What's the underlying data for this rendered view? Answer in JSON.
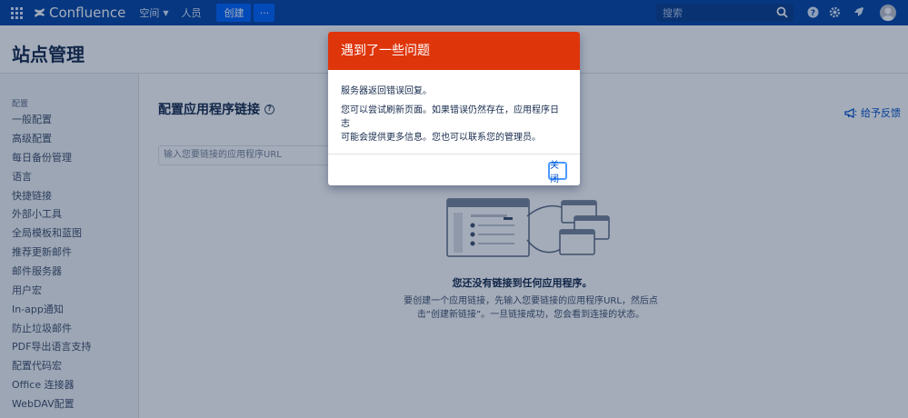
{
  "topnav": {
    "logo_text": "Confluence",
    "spaces_label": "空间",
    "people_label": "人员",
    "create_label": "创建",
    "more_label": "···",
    "search_placeholder": "搜索"
  },
  "header": {
    "title": "站点管理"
  },
  "sidebar": {
    "heading": "配置",
    "items": [
      {
        "label": "一般配置"
      },
      {
        "label": "高级配置"
      },
      {
        "label": "每日备份管理"
      },
      {
        "label": "语言"
      },
      {
        "label": "快捷链接"
      },
      {
        "label": "外部小工具"
      },
      {
        "label": "全局模板和蓝图"
      },
      {
        "label": "推荐更新邮件"
      },
      {
        "label": "邮件服务器"
      },
      {
        "label": "用户宏"
      },
      {
        "label": "In-app通知"
      },
      {
        "label": "防止垃圾邮件"
      },
      {
        "label": "PDF导出语言支持"
      },
      {
        "label": "配置代码宏"
      },
      {
        "label": "Office 连接器"
      },
      {
        "label": "WebDAV配置"
      }
    ]
  },
  "main": {
    "title": "配置应用程序链接",
    "feedback_label": "给予反馈",
    "url_placeholder": "输入您要链接的应用程序URL",
    "empty_title": "您还没有链接到任何应用程序。",
    "empty_desc_line1": "要创建一个应用链接，先输入您要链接的应用程序URL，然后点",
    "empty_desc_line2": "击“创建新链接”。一旦链接成功，您会看到连接的状态。"
  },
  "dialog": {
    "title": "遇到了一些问题",
    "message": "服务器返回错误回复。",
    "detail_line1": "您可以尝试刷新页面。如果错误仍然存在，应用程序日志",
    "detail_line2": "可能会提供更多信息。您也可以联系您的管理员。",
    "close_label": "关闭"
  },
  "colors": {
    "topnav": "#0747a6",
    "create_button": "#0065ff",
    "dialog_header": "#de350b",
    "link": "#0052cc"
  }
}
